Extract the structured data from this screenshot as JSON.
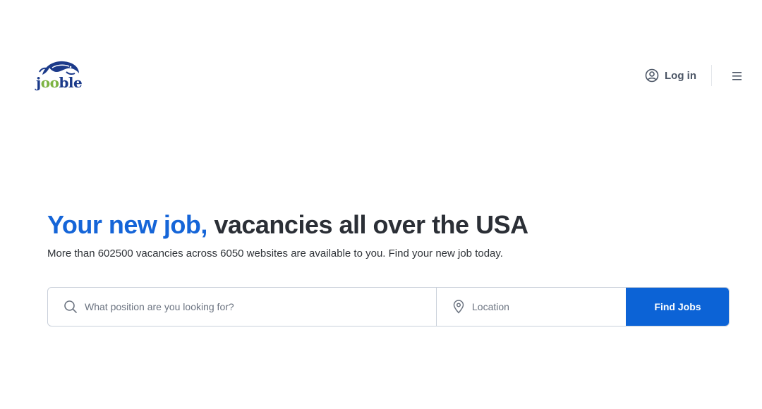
{
  "header": {
    "logo": {
      "part1": "j",
      "part2": "oo",
      "part3": "ble"
    },
    "login_label": "Log in"
  },
  "hero": {
    "title_accent": "Your new job,",
    "title_rest": " vacancies all over the USA",
    "subtitle": "More than 602500 vacancies across 6050 websites are available to you. Find your new job today."
  },
  "search": {
    "position_placeholder": "What position are you looking for?",
    "location_placeholder": "Location",
    "button_label": "Find Jobs"
  },
  "colors": {
    "accent": "#1565d8",
    "button": "#0c63d6",
    "logo_blue": "#1b3a8a",
    "logo_green": "#7cb342"
  },
  "icons": {
    "user": "user-circle-icon",
    "menu": "hamburger-menu-icon",
    "search": "search-icon",
    "location": "location-pin-icon"
  }
}
